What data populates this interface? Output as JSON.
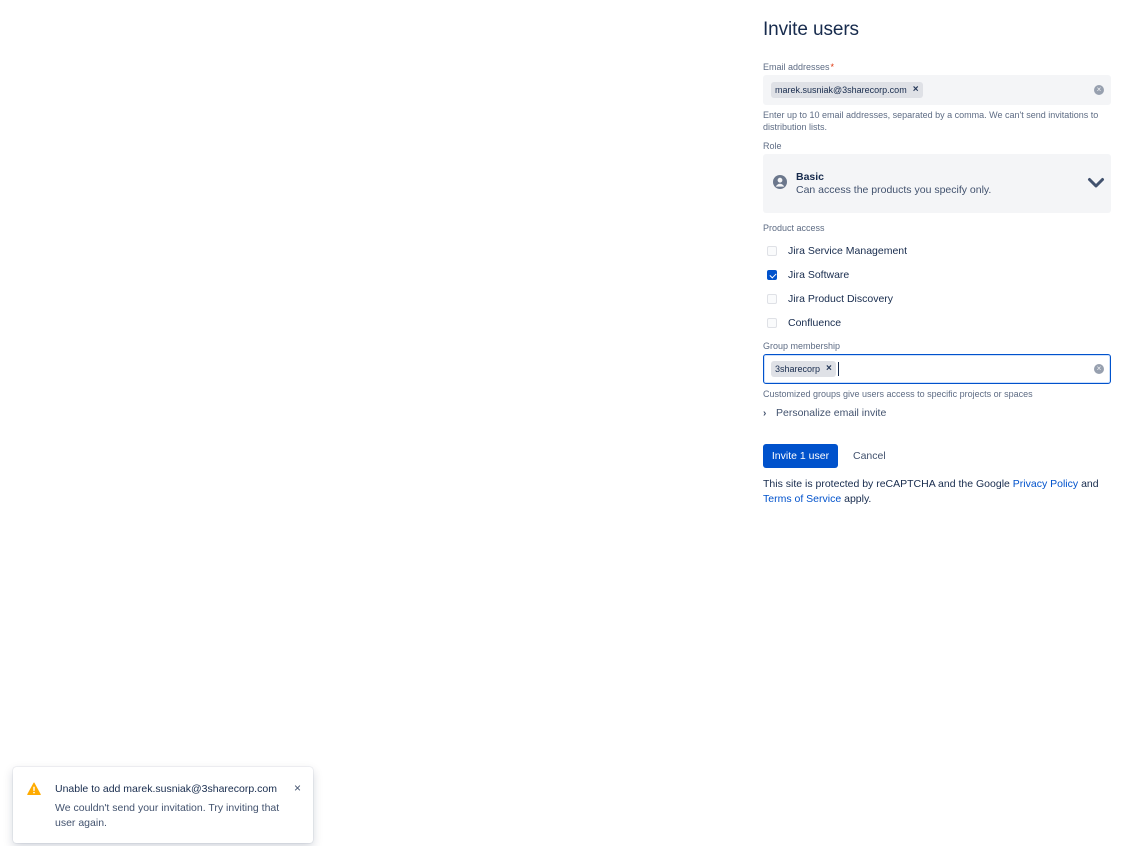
{
  "invite": {
    "title": "Invite users",
    "email": {
      "label": "Email addresses",
      "required_mark": "*",
      "tags": [
        "marek.susniak@3sharecorp.com"
      ],
      "tag_remove_glyph": "×",
      "clear_glyph": "×",
      "helper": "Enter up to 10 email addresses, separated by a comma. We can't send invitations to distribution lists."
    },
    "role": {
      "label": "Role",
      "selected_name": "Basic",
      "selected_description": "Can access the products you specify only.",
      "icon": "user-avatar-icon",
      "chevron_icon": "chevron-down-icon"
    },
    "product_access": {
      "label": "Product access",
      "items": [
        {
          "label": "Jira Service Management",
          "checked": false
        },
        {
          "label": "Jira Software",
          "checked": true
        },
        {
          "label": "Jira Product Discovery",
          "checked": false
        },
        {
          "label": "Confluence",
          "checked": false
        }
      ]
    },
    "group": {
      "label": "Group membership",
      "tags": [
        "3sharecorp"
      ],
      "tag_remove_glyph": "×",
      "clear_glyph": "×",
      "helper": "Customized groups give users access to specific projects or spaces"
    },
    "personalize": {
      "label": "Personalize email invite",
      "chevron_glyph": "›"
    },
    "actions": {
      "invite_label": "Invite 1 user",
      "cancel_label": "Cancel"
    },
    "recaptcha": {
      "prefix": "This site is protected by reCAPTCHA and the Google ",
      "privacy_link": "Privacy Policy",
      "middle": " and ",
      "terms_link": "Terms of Service",
      "suffix": " apply."
    }
  },
  "flag": {
    "icon": "warning-icon",
    "title": "Unable to add marek.susniak@3sharecorp.com",
    "body": "We couldn't send your invitation. Try inviting that user again.",
    "close_glyph": "×"
  },
  "colors": {
    "primary": "#0052cc",
    "text": "#172b4d",
    "subtle_text": "#5e6c84",
    "warning": "#ffab00",
    "field_bg": "#f4f5f7"
  }
}
